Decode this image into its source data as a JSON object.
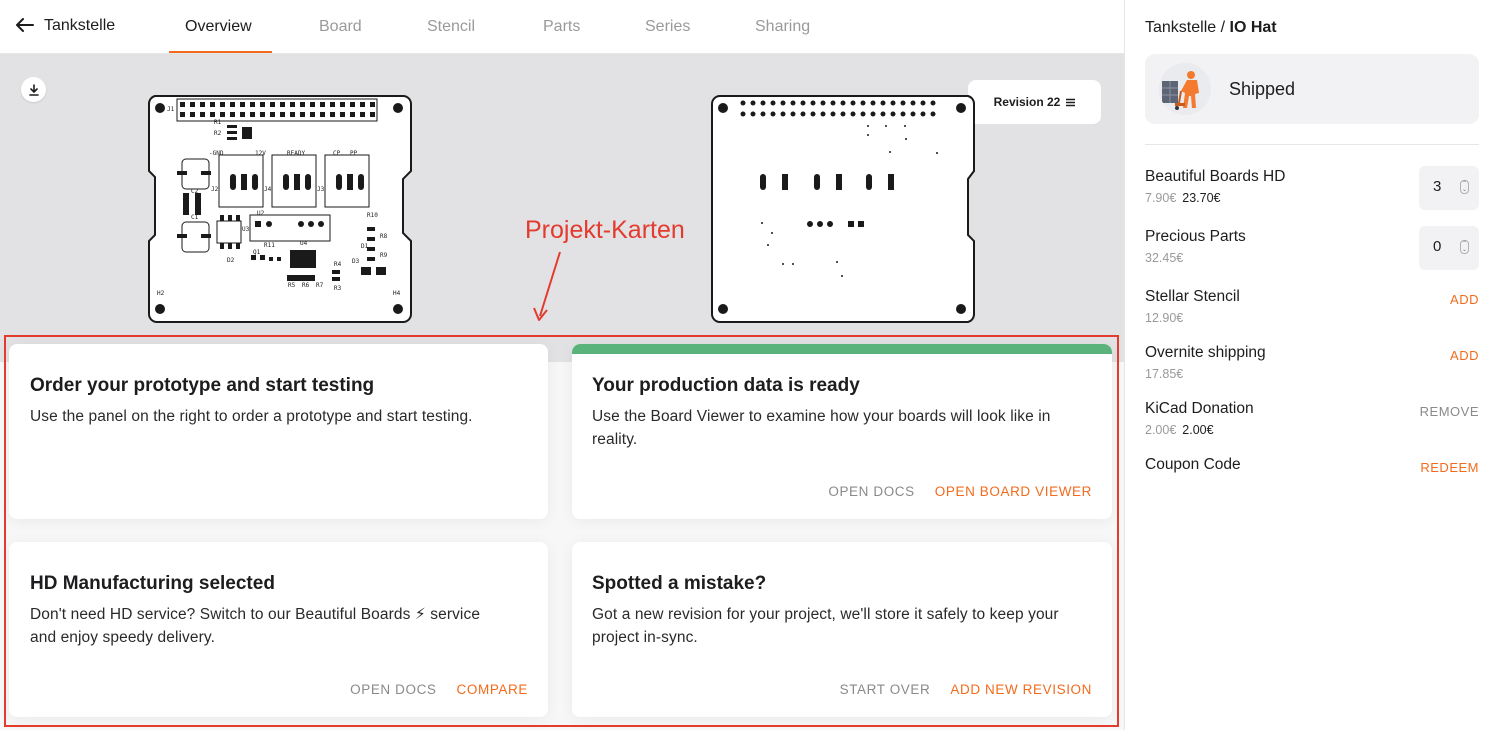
{
  "nav": {
    "back_label": "Tankstelle",
    "tabs": [
      {
        "label": "Overview"
      },
      {
        "label": "Board"
      },
      {
        "label": "Stencil"
      },
      {
        "label": "Parts"
      },
      {
        "label": "Series"
      },
      {
        "label": "Sharing"
      }
    ]
  },
  "viewer": {
    "revision_label": "Revision 22"
  },
  "annotation": {
    "label": "Projekt-Karten"
  },
  "cards": [
    {
      "title": "Order your prototype and start testing",
      "text": "Use the panel on the right to order a prototype and start testing."
    },
    {
      "title": "Your production data is ready",
      "text": "Use the Board Viewer to examine how your boards will look like in reality.",
      "action_secondary": "OPEN DOCS",
      "action_primary": "OPEN BOARD VIEWER"
    },
    {
      "title": "HD Manufacturing selected",
      "text": "Don't need HD service? Switch to our Beautiful Boards ⚡ service and enjoy speedy delivery.",
      "action_secondary": "OPEN DOCS",
      "action_primary": "COMPARE"
    },
    {
      "title": "Spotted a mistake?",
      "text": "Got a new revision for your project, we'll store it safely to keep your project in-sync.",
      "action_secondary": "START OVER",
      "action_primary": "ADD NEW REVISION"
    }
  ],
  "panel": {
    "crumb_project": "Tankstelle",
    "crumb_sep": "/",
    "crumb_board": "IO Hat",
    "status": "Shipped",
    "items": [
      {
        "name": "Beautiful Boards HD",
        "price": "7.90€",
        "total": "23.70€",
        "quantity": "3"
      },
      {
        "name": "Precious Parts",
        "price": "32.45€",
        "quantity": "0"
      },
      {
        "name": "Stellar Stencil",
        "price": "12.90€",
        "action": "ADD"
      },
      {
        "name": "Overnite shipping",
        "price": "17.85€",
        "action": "ADD"
      },
      {
        "name": "KiCad Donation",
        "price": "2.00€",
        "total": "2.00€",
        "action": "REMOVE"
      },
      {
        "name": "Coupon Code",
        "action": "REDEEM"
      }
    ]
  },
  "pcb_front_labels": {
    "r1": "R1",
    "r2": "R2",
    "gnd": "-GND",
    "v12": "12V",
    "ready": "READY",
    "cp": "CP",
    "pp": "PP",
    "c2": "C2",
    "c1": "C1",
    "j2": "J2",
    "j4": "J4",
    "j3": "J3",
    "u2": "U2",
    "u3": "U3",
    "r10": "R10",
    "r8": "R8",
    "d1": "D1",
    "r9": "R9",
    "r11": "R11",
    "q1": "Q1",
    "u4": "U4",
    "d2": "D2",
    "r4": "R4",
    "d3": "D3",
    "r3": "R3",
    "r5": "R5",
    "r6": "R6",
    "r7": "R7",
    "h2": "H2",
    "h4": "H4",
    "j1": "J1"
  },
  "colors": {
    "accent": "#f26b1d",
    "success": "#5ab37a",
    "annotation": "#e33b2e"
  }
}
